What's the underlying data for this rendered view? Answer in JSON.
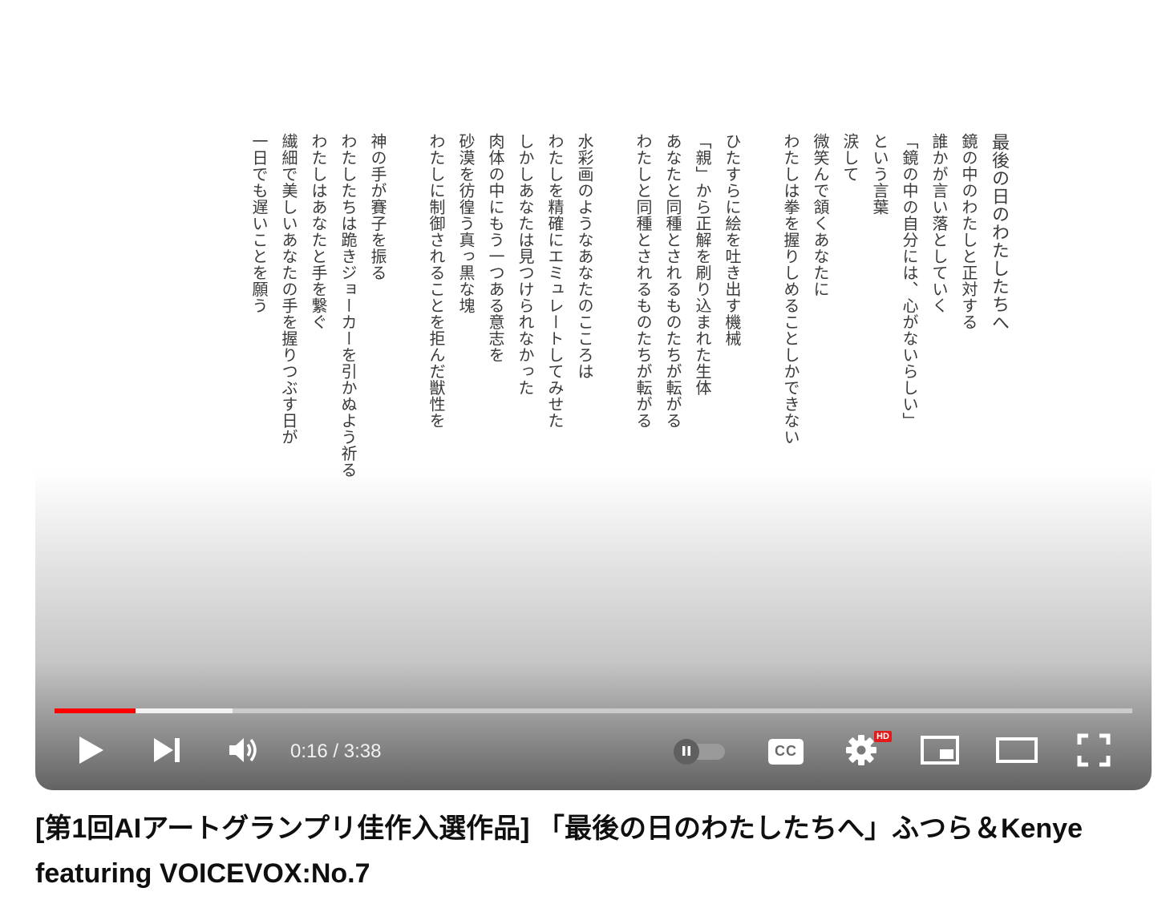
{
  "poem": {
    "title": "最後の日のわたしたちへ",
    "stanzas": [
      [
        "鏡の中のわたしと正対する",
        "誰かが言い落としていく",
        "「鏡の中の自分には、心がないらしい」",
        "という言葉",
        "涙して",
        "微笑んで頷くあなたに",
        "わたしは拳を握りしめることしかできない"
      ],
      [
        "ひたすらに絵を吐き出す機械",
        "「親」から正解を刷り込まれた生体",
        "あなたと同種とされるものたちが転がる",
        "わたしと同種とされるものたちが転がる"
      ],
      [
        "水彩画のようなあなたのこころは",
        "わたしを精確にエミュレートしてみせた",
        "しかしあなたは見つけられなかった",
        "肉体の中にもう一つある意志を",
        "砂漠を彷徨う真っ黒な塊",
        "わたしに制御されることを拒んだ獣性を"
      ],
      [
        "神の手が賽子を振る",
        "わたしたちは跪きジョーカーを引かぬよう祈る",
        "わたしはあなたと手を繋ぐ",
        "繊細で美しいあなたの手を握りつぶす日が",
        "一日でも遅いことを願う"
      ]
    ]
  },
  "player": {
    "progress_fraction": 0.075,
    "buffered_fraction": 0.165,
    "current_time": "0:16",
    "separator": " / ",
    "duration": "3:38",
    "hd_badge": "HD",
    "cc_label": "CC",
    "icons": [
      "play-icon",
      "next-icon",
      "volume-icon",
      "autoplay-pause-icon",
      "captions-icon",
      "settings-gear-icon",
      "miniplayer-icon",
      "theater-mode-icon",
      "fullscreen-icon"
    ]
  },
  "video": {
    "title": "[第1回AIアートグランプリ佳作入選作品] 「最後の日のわたしたちへ」ふつら＆Kenye featuring VOICEVOX:No.7"
  },
  "colors": {
    "progress_played": "#ff0000",
    "hd_badge": "#e31b1b",
    "poem_text": "#3a3a3a"
  }
}
